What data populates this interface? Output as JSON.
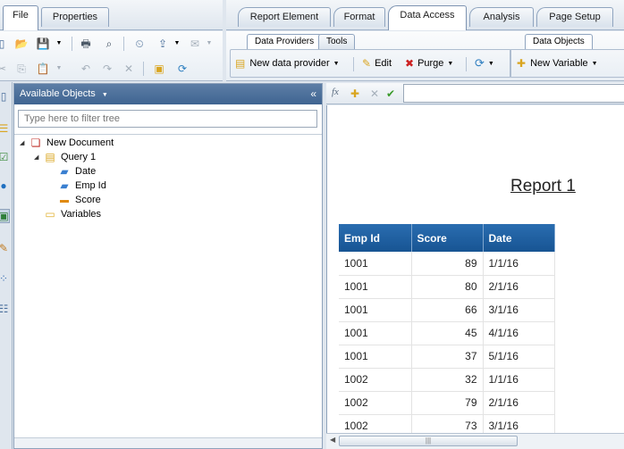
{
  "left_tabs": [
    "File",
    "Properties"
  ],
  "right_tabs": [
    "Report Element",
    "Format",
    "Data Access",
    "Analysis",
    "Page Setup"
  ],
  "active_left_tab": "File",
  "active_right_tab": "Data Access",
  "data_access": {
    "subtabs": [
      "Data Providers",
      "Tools"
    ],
    "active_subtab": "Data Providers",
    "new_data_provider": "New data provider",
    "edit": "Edit",
    "purge": "Purge"
  },
  "data_objects": {
    "tab": "Data Objects",
    "new_variable": "New Variable"
  },
  "panel": {
    "title": "Available Objects",
    "filter_placeholder": "Type here to filter tree",
    "collapse_glyph": "«"
  },
  "tree": {
    "root": "New Document",
    "query": "Query 1",
    "fields": [
      "Date",
      "Emp Id",
      "Score"
    ],
    "variables": "Variables"
  },
  "formula": {
    "fx": "fx"
  },
  "report": {
    "title": "Report 1",
    "headers": [
      "Emp Id",
      "Score",
      "Date"
    ],
    "rows": [
      [
        "1001",
        "89",
        "1/1/16"
      ],
      [
        "1001",
        "80",
        "2/1/16"
      ],
      [
        "1001",
        "66",
        "3/1/16"
      ],
      [
        "1001",
        "45",
        "4/1/16"
      ],
      [
        "1001",
        "37",
        "5/1/16"
      ],
      [
        "1002",
        "32",
        "1/1/16"
      ],
      [
        "1002",
        "79",
        "2/1/16"
      ],
      [
        "1002",
        "73",
        "3/1/16"
      ]
    ]
  },
  "colors": {
    "panel_header": "#4a6f9c",
    "table_header": "#1f5e9f",
    "accent_green": "#3a9a2a"
  }
}
